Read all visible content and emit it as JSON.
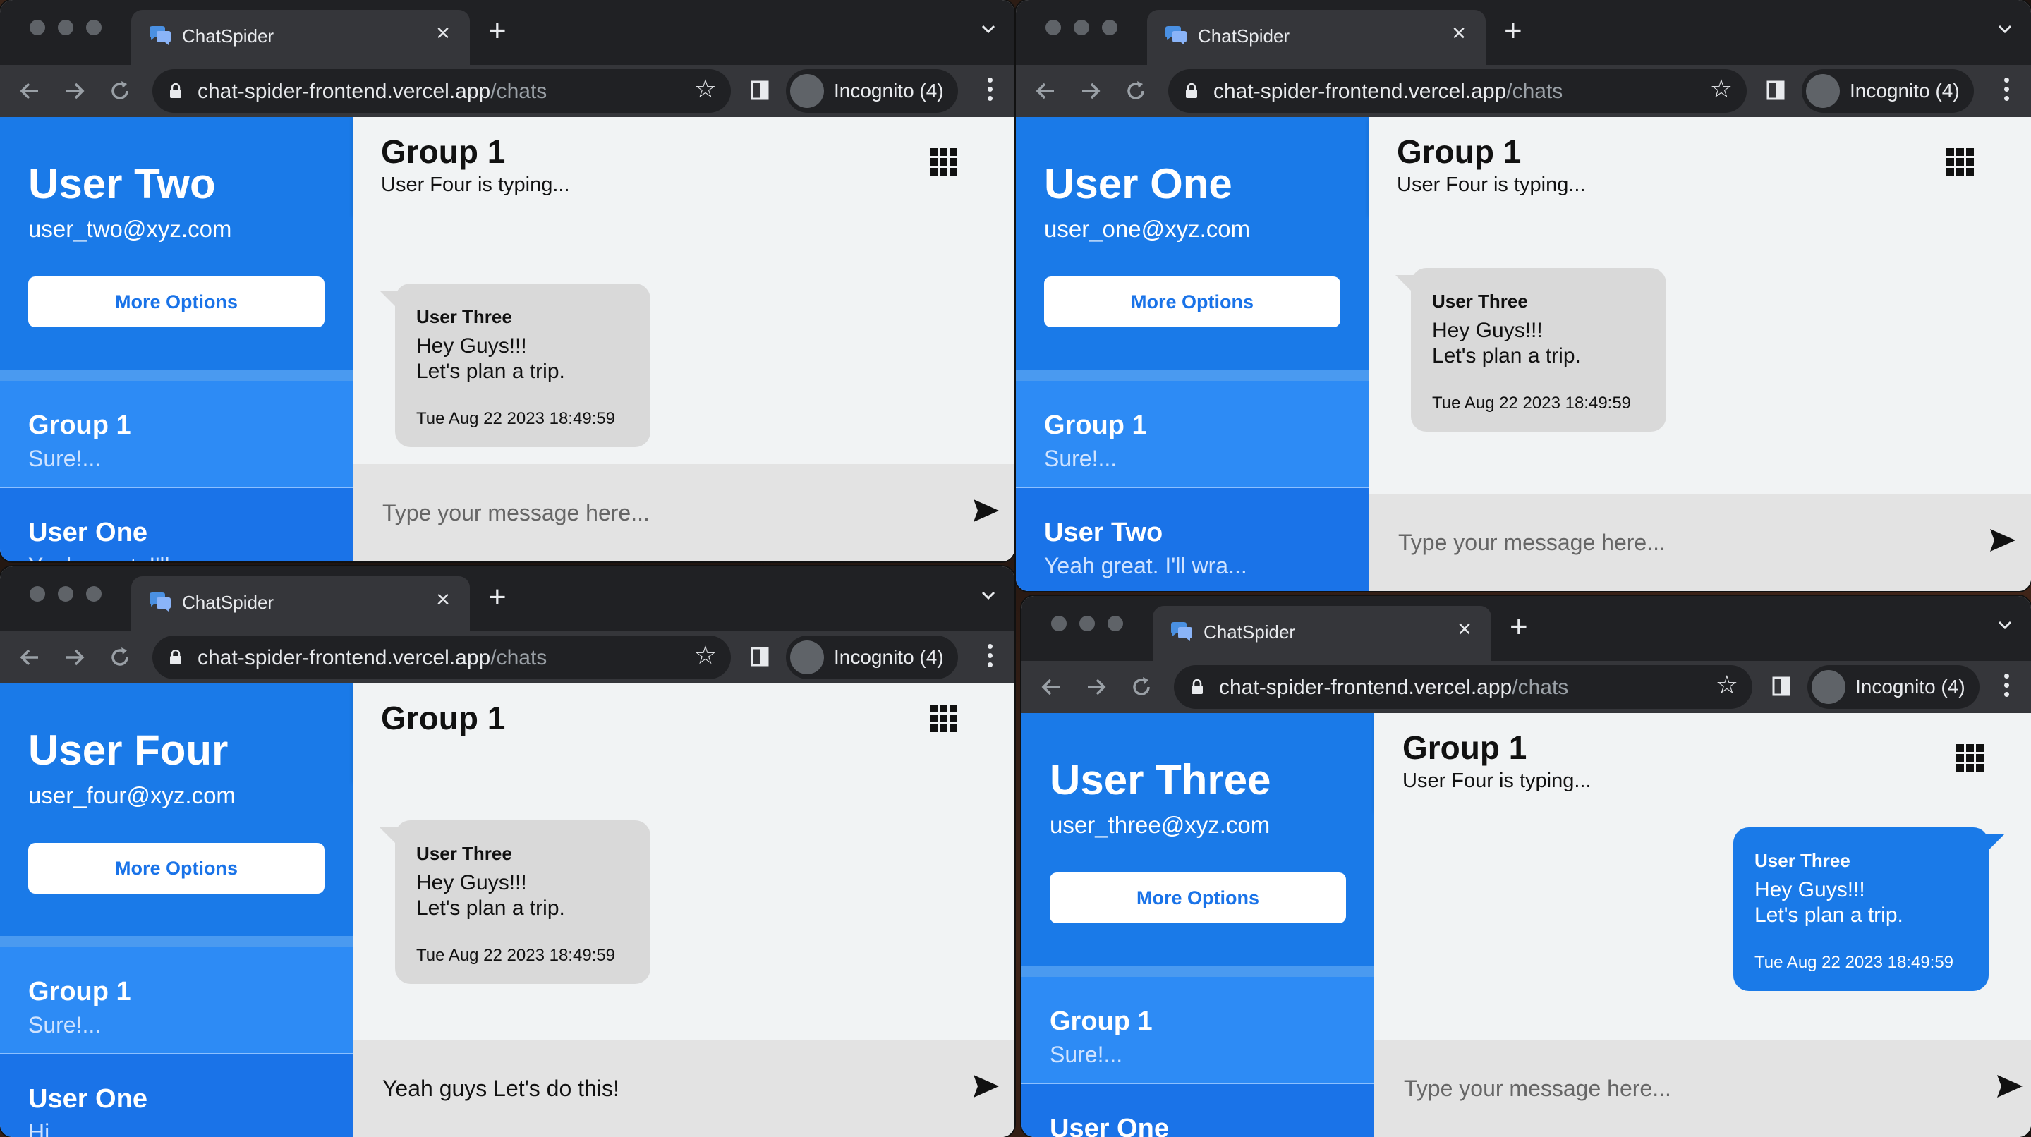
{
  "browser": {
    "tab_title": "ChatSpider",
    "url_host": "chat-spider-frontend.vercel.app",
    "url_path": "/chats",
    "incognito_label": "Incognito (4)"
  },
  "colors": {
    "accent": "#1a73e8",
    "sidebar_item": "#2d8bf5",
    "own_bubble": "#1a7ae8",
    "other_bubble": "#d9d9d9"
  },
  "windows": [
    {
      "user": {
        "name": "User Two",
        "email": "user_two@xyz.com"
      },
      "more_options_label": "More Options",
      "chats": [
        {
          "name": "Group 1",
          "last": "Sure!..."
        },
        {
          "name": "User One",
          "last": "Yeah great. I'll wra..."
        }
      ],
      "header": {
        "title": "Group 1",
        "status": "User Four is typing..."
      },
      "message": {
        "sender": "User Three",
        "line1": "Hey Guys!!!",
        "line2": "Let's plan a trip.",
        "time": "Tue Aug 22 2023 18:49:59"
      },
      "input": {
        "value": "",
        "placeholder": "Type your message here..."
      }
    },
    {
      "user": {
        "name": "User One",
        "email": "user_one@xyz.com"
      },
      "more_options_label": "More Options",
      "chats": [
        {
          "name": "Group 1",
          "last": "Sure!..."
        },
        {
          "name": "User Two",
          "last": "Yeah great. I'll wra..."
        }
      ],
      "header": {
        "title": "Group 1",
        "status": "User Four is typing..."
      },
      "message": {
        "sender": "User Three",
        "line1": "Hey Guys!!!",
        "line2": "Let's plan a trip.",
        "time": "Tue Aug 22 2023 18:49:59"
      },
      "input": {
        "value": "",
        "placeholder": "Type your message here..."
      }
    },
    {
      "user": {
        "name": "User Four",
        "email": "user_four@xyz.com"
      },
      "more_options_label": "More Options",
      "chats": [
        {
          "name": "Group 1",
          "last": "Sure!..."
        },
        {
          "name": "User One",
          "last": "Hi..."
        }
      ],
      "header": {
        "title": "Group 1",
        "status": ""
      },
      "message": {
        "sender": "User Three",
        "line1": "Hey Guys!!!",
        "line2": "Let's plan a trip.",
        "time": "Tue Aug 22 2023 18:49:59"
      },
      "input": {
        "value": "Yeah guys Let's do this!",
        "placeholder": "Type your message here..."
      }
    },
    {
      "user": {
        "name": "User Three",
        "email": "user_three@xyz.com"
      },
      "more_options_label": "More Options",
      "chats": [
        {
          "name": "Group 1",
          "last": "Sure!..."
        },
        {
          "name": "User One",
          "last": ""
        }
      ],
      "header": {
        "title": "Group 1",
        "status": "User Four is typing..."
      },
      "message": {
        "sender": "User Three",
        "line1": "Hey Guys!!!",
        "line2": "Let's plan a trip.",
        "time": "Tue Aug 22 2023 18:49:59"
      },
      "input": {
        "value": "",
        "placeholder": "Type your message here..."
      }
    }
  ]
}
